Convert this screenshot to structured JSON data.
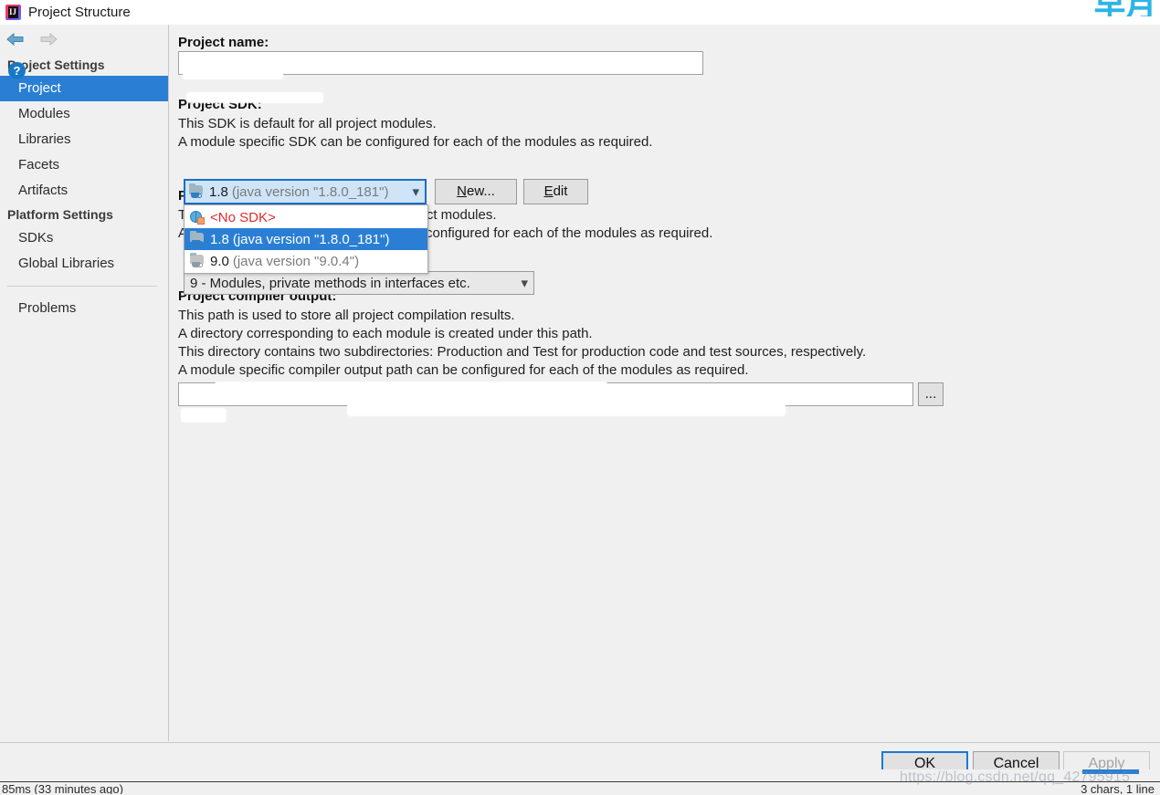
{
  "window": {
    "title": "Project Structure",
    "app_icon": "intellij-idea-logo",
    "logo_text": "IJ",
    "top_right_glyphs": "早月"
  },
  "nav": {
    "back_icon": "arrow-left-icon",
    "forward_icon": "arrow-right-icon"
  },
  "sidebar": {
    "groups": [
      {
        "label": "Project Settings",
        "items": [
          {
            "label": "Project",
            "selected": true
          },
          {
            "label": "Modules",
            "selected": false
          },
          {
            "label": "Libraries",
            "selected": false
          },
          {
            "label": "Facets",
            "selected": false
          },
          {
            "label": "Artifacts",
            "selected": false
          }
        ]
      },
      {
        "label": "Platform Settings",
        "items": [
          {
            "label": "SDKs",
            "selected": false
          },
          {
            "label": "Global Libraries",
            "selected": false
          }
        ]
      }
    ],
    "problems_label": "Problems"
  },
  "main": {
    "project_name": {
      "label": "Project name:",
      "value": "",
      "placeholder": ""
    },
    "project_sdk": {
      "label": "Project SDK:",
      "desc_line_1": "This SDK is default for all project modules.",
      "desc_line_2": "A module specific SDK can be configured for each of the modules as required.",
      "selected_name": "1.8",
      "selected_version": "(java version \"1.8.0_181\")",
      "caret_icon": "chevron-down-icon",
      "new_button": {
        "mnemonic": "N",
        "rest": "ew..."
      },
      "edit_button": {
        "mnemonic": "E",
        "rest": "dit"
      },
      "options": [
        {
          "name": "<No SDK>",
          "version": "",
          "icon": "no-sdk-icon",
          "selected": false,
          "disabled": false
        },
        {
          "name": "1.8",
          "version": "(java version \"1.8.0_181\")",
          "icon": "sdk-icon",
          "selected": true,
          "disabled": false
        },
        {
          "name": "9.0",
          "version": "(java version \"9.0.4\")",
          "icon": "sdk-icon-dim",
          "selected": false,
          "disabled": true
        }
      ]
    },
    "project_language_level": {
      "label": "Project language level:",
      "desc_line_1": "This language level is default for all project modules.",
      "desc_line_2": "A module specific language level can be configured for each of the modules as required.",
      "value": "9 - Modules, private methods in interfaces etc.",
      "caret_icon": "chevron-down-icon"
    },
    "project_compiler_output": {
      "label": "Project compiler output:",
      "desc_line_1": "This path is used to store all project compilation results.",
      "desc_line_2": "A directory corresponding to each module is created under this path.",
      "desc_line_3": "This directory contains two subdirectories: Production and Test for production code and test sources, respectively.",
      "desc_line_4": "A module specific compiler output path can be configured for each of the modules as required.",
      "value": "",
      "browse_button_label": "...",
      "browse_button_icon": "ellipsis-icon"
    }
  },
  "footer": {
    "help_icon": "help-question-icon",
    "help_label": "?",
    "ok_label": "OK",
    "cancel_label": "Cancel",
    "apply_label": "Apply"
  },
  "ide_status_bar": {
    "left_text": "85ms (33 minutes ago)",
    "right_text": "3 chars, 1 line"
  },
  "watermark": {
    "text": "https://blog.csdn.net/qq_42795915"
  },
  "colors": {
    "accent_blue": "#2a7fd4",
    "focus_blue": "#1a7ad4",
    "combo_fill": "#cfe4f7",
    "panel_bg": "#f0f0f0",
    "error_red": "#dd2b2b",
    "glyph_cyan": "#29b6e8"
  }
}
